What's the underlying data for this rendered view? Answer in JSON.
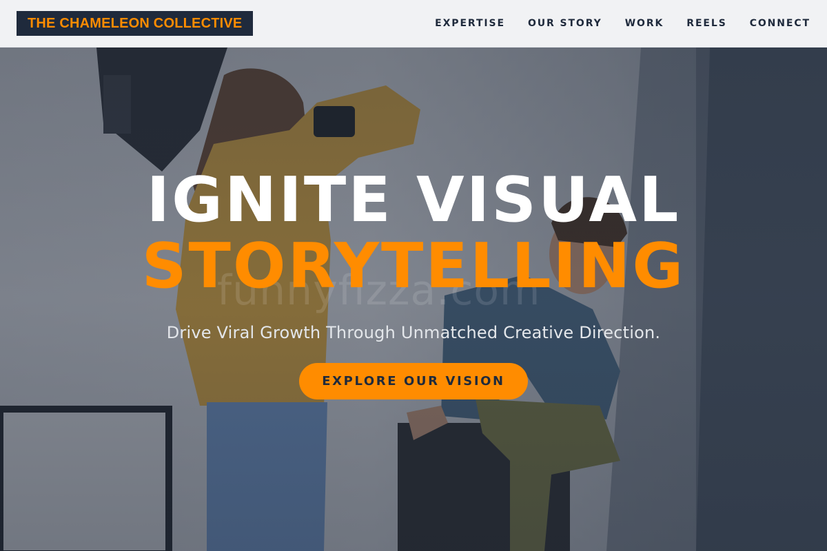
{
  "brand": {
    "name": "THE CHAMELEON COLLECTIVE"
  },
  "nav": {
    "items": [
      {
        "label": "EXPERTISE"
      },
      {
        "label": "OUR STORY"
      },
      {
        "label": "WORK"
      },
      {
        "label": "REELS"
      },
      {
        "label": "CONNECT"
      }
    ]
  },
  "hero": {
    "headline_line1": "IGNITE VISUAL",
    "headline_line2": "STORYTELLING",
    "subtitle": "Drive Viral Growth Through Unmatched Creative Direction.",
    "cta_label": "EXPLORE OUR VISION",
    "watermark": "funnyfizza.com"
  },
  "colors": {
    "accent": "#ff8c00",
    "navy": "#1f2a3c",
    "header_bg": "#f1f2f4"
  }
}
